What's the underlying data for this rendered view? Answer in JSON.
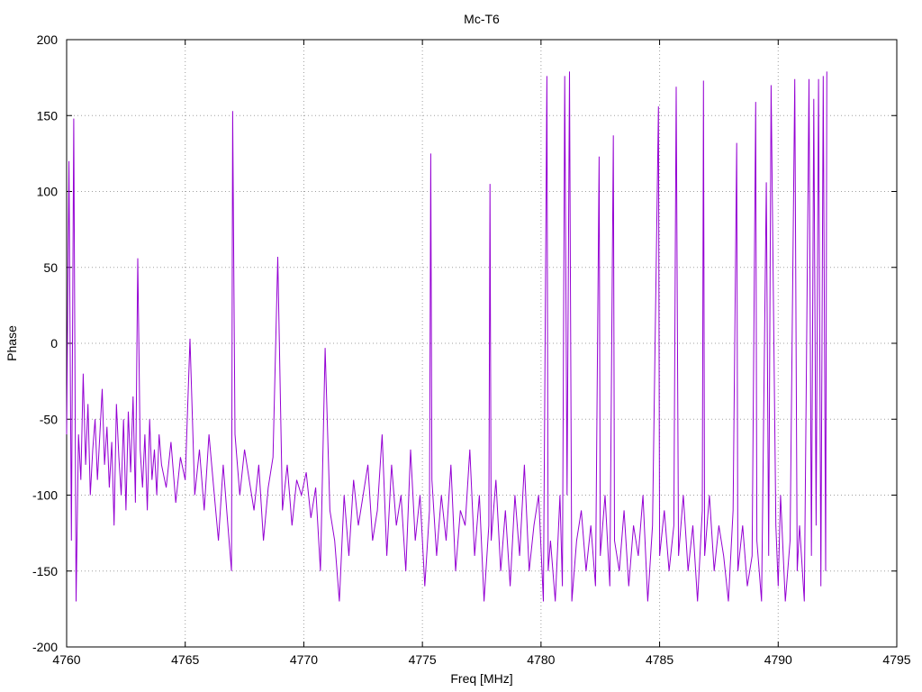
{
  "chart_data": {
    "type": "line",
    "title": "Mc-T6",
    "xlabel": "Freq [MHz]",
    "ylabel": "Phase",
    "xlim": [
      4760,
      4795
    ],
    "ylim": [
      -200,
      200
    ],
    "x_ticks": [
      "4760",
      "4765",
      "4770",
      "4775",
      "4780",
      "4785",
      "4790",
      "4795"
    ],
    "y_ticks": [
      "200",
      "150",
      "100",
      "50",
      "0",
      "-50",
      "-100",
      "-150",
      "-200"
    ],
    "grid": true,
    "legend": "none",
    "line_color": "#9400d3",
    "series": [
      {
        "x": [
          4760.0,
          4760.1,
          4760.2,
          4760.3,
          4760.4,
          4760.5,
          4760.6,
          4760.7,
          4760.8,
          4760.9,
          4761.0,
          4761.1,
          4761.2,
          4761.3,
          4761.4,
          4761.5,
          4761.6,
          4761.7,
          4761.8,
          4761.9,
          4762.0,
          4762.1,
          4762.2,
          4762.3,
          4762.4,
          4762.5,
          4762.6,
          4762.7,
          4762.8,
          4762.9,
          4763.0,
          4763.1,
          4763.2,
          4763.3,
          4763.4,
          4763.5,
          4763.6,
          4763.7,
          4763.8,
          4763.9,
          4764.0,
          4764.2,
          4764.4,
          4764.6,
          4764.8,
          4765.0,
          4765.2,
          4765.4,
          4765.6,
          4765.8,
          4766.0,
          4766.2,
          4766.4,
          4766.6,
          4766.8,
          4766.95,
          4767.0,
          4767.1,
          4767.3,
          4767.5,
          4767.7,
          4767.9,
          4768.1,
          4768.3,
          4768.5,
          4768.7,
          4768.9,
          4769.1,
          4769.3,
          4769.5,
          4769.7,
          4769.9,
          4770.1,
          4770.3,
          4770.5,
          4770.7,
          4770.9,
          4771.1,
          4771.3,
          4771.5,
          4771.7,
          4771.9,
          4772.1,
          4772.3,
          4772.5,
          4772.7,
          4772.9,
          4773.1,
          4773.3,
          4773.5,
          4773.7,
          4773.9,
          4774.1,
          4774.3,
          4774.5,
          4774.7,
          4774.9,
          4775.1,
          4775.3,
          4775.35,
          4775.4,
          4775.6,
          4775.8,
          4776.0,
          4776.2,
          4776.4,
          4776.6,
          4776.8,
          4777.0,
          4777.2,
          4777.4,
          4777.6,
          4777.8,
          4777.85,
          4777.9,
          4778.1,
          4778.3,
          4778.5,
          4778.7,
          4778.9,
          4779.1,
          4779.3,
          4779.5,
          4779.7,
          4779.9,
          4780.1,
          4780.25,
          4780.3,
          4780.4,
          4780.6,
          4780.8,
          4780.9,
          4781.0,
          4781.1,
          4781.2,
          4781.3,
          4781.5,
          4781.7,
          4781.9,
          4782.1,
          4782.3,
          4782.45,
          4782.5,
          4782.7,
          4782.9,
          4783.05,
          4783.1,
          4783.3,
          4783.5,
          4783.7,
          4783.9,
          4784.1,
          4784.3,
          4784.5,
          4784.7,
          4784.95,
          4785.0,
          4785.2,
          4785.4,
          4785.6,
          4785.7,
          4785.8,
          4786.0,
          4786.2,
          4786.4,
          4786.6,
          4786.8,
          4786.85,
          4786.9,
          4787.1,
          4787.3,
          4787.5,
          4787.7,
          4787.9,
          4788.1,
          4788.25,
          4788.3,
          4788.5,
          4788.7,
          4788.9,
          4789.05,
          4789.1,
          4789.3,
          4789.5,
          4789.6,
          4789.7,
          4789.9,
          4790.0,
          4790.1,
          4790.3,
          4790.5,
          4790.7,
          4790.8,
          4790.9,
          4791.1,
          4791.3,
          4791.4,
          4791.5,
          4791.6,
          4791.7,
          4791.8,
          4791.9,
          4792.0,
          4792.05
        ],
        "values": [
          -60,
          120,
          -130,
          148,
          -170,
          -60,
          -90,
          -20,
          -80,
          -40,
          -100,
          -70,
          -50,
          -90,
          -60,
          -30,
          -80,
          -55,
          -95,
          -65,
          -120,
          -40,
          -75,
          -100,
          -50,
          -110,
          -45,
          -85,
          -35,
          -105,
          56,
          -70,
          -95,
          -60,
          -110,
          -50,
          -90,
          -70,
          -100,
          -60,
          -80,
          -95,
          -65,
          -105,
          -75,
          -90,
          3,
          -100,
          -70,
          -110,
          -60,
          -95,
          -130,
          -80,
          -120,
          -150,
          153,
          -60,
          -100,
          -70,
          -90,
          -110,
          -80,
          -130,
          -95,
          -75,
          57,
          -110,
          -80,
          -120,
          -90,
          -100,
          -85,
          -115,
          -95,
          -150,
          -3,
          -110,
          -130,
          -170,
          -100,
          -140,
          -90,
          -120,
          -100,
          -80,
          -130,
          -110,
          -60,
          -140,
          -80,
          -120,
          -100,
          -150,
          -70,
          -130,
          -100,
          -160,
          -110,
          125,
          -90,
          -140,
          -100,
          -130,
          -80,
          -150,
          -110,
          -120,
          -70,
          -140,
          -100,
          -170,
          -120,
          105,
          -130,
          -90,
          -150,
          -110,
          -160,
          -100,
          -140,
          -80,
          -150,
          -120,
          -100,
          -170,
          176,
          -150,
          -130,
          -170,
          -100,
          -160,
          176,
          -100,
          179,
          -170,
          -130,
          -110,
          -150,
          -120,
          -160,
          123,
          -140,
          -100,
          -160,
          137,
          -130,
          -150,
          -110,
          -160,
          -120,
          -140,
          -100,
          -170,
          -120,
          156,
          -140,
          -110,
          -150,
          -120,
          169,
          -140,
          -100,
          -150,
          -120,
          -170,
          -110,
          173,
          -140,
          -100,
          -150,
          -120,
          -140,
          -170,
          -110,
          132,
          -150,
          -120,
          -160,
          -140,
          159,
          -130,
          -170,
          106,
          -140,
          170,
          -120,
          -160,
          -100,
          -170,
          -130,
          174,
          -150,
          -120,
          -170,
          174,
          -140,
          161,
          -120,
          174,
          -160,
          176,
          -150,
          179
        ]
      }
    ]
  }
}
